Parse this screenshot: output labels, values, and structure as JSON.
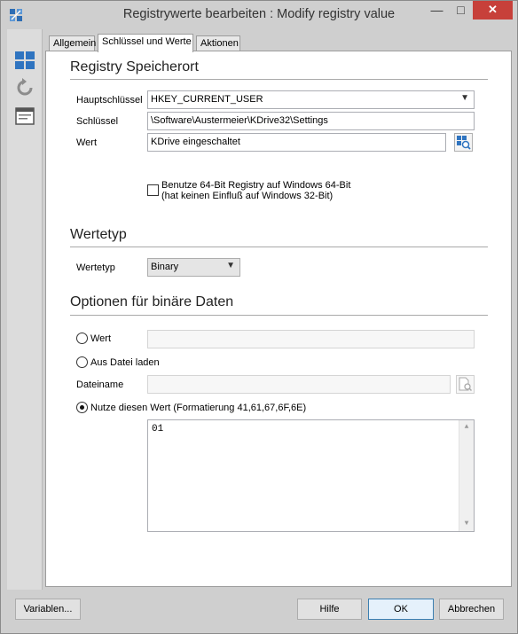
{
  "window": {
    "title": "Registrywerte bearbeiten : Modify registry value"
  },
  "titlebar": {
    "minimize": "—",
    "maximize": "□",
    "close": "✕"
  },
  "tools": [
    "layout-grid-icon",
    "refresh-icon",
    "window-icon"
  ],
  "tabs": [
    {
      "label": "Allgemein"
    },
    {
      "label": "Schlüssel und Werte"
    },
    {
      "label": "Aktionen"
    }
  ],
  "registry": {
    "heading": "Registry Speicherort",
    "hive_label": "Hauptschlüssel",
    "hive_value": "HKEY_CURRENT_USER",
    "key_label": "Schlüssel",
    "key_value": "\\Software\\Austermeier\\KDrive32\\Settings",
    "value_label": "Wert",
    "value_value": "KDrive eingeschaltet",
    "use64_line1": "Benutze 64-Bit Registry auf Windows 64-Bit",
    "use64_line2": "(hat keinen Einfluß auf Windows 32-Bit)"
  },
  "valuetype": {
    "heading": "Wertetyp",
    "label": "Wertetyp",
    "selected": "Binary"
  },
  "binary": {
    "heading": "Optionen für binäre Daten",
    "opt_value_label": "Wert",
    "opt_file_label": "Aus Datei laden",
    "filename_label": "Dateiname",
    "opt_use_label": "Nutze diesen Wert (Formatierung 41,61,67,6F,6E)",
    "data": "01"
  },
  "footer": {
    "variables": "Variablen...",
    "help": "Hilfe",
    "ok": "OK",
    "cancel": "Abbrechen"
  },
  "colors": {
    "accent": "#3c7fb1",
    "close": "#c7403a"
  }
}
